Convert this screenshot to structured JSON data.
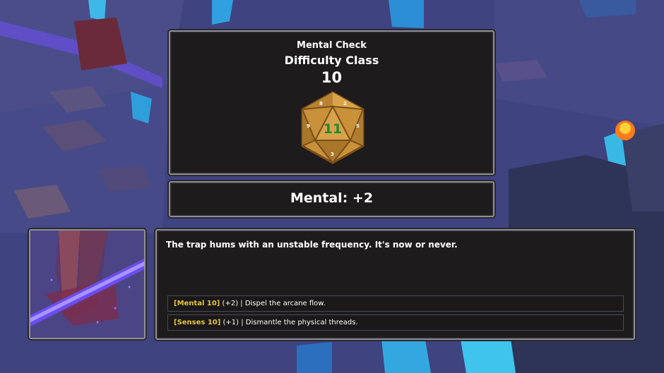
{
  "check": {
    "title": "Mental Check",
    "dc_label": "Difficulty Class",
    "dc_value": "10"
  },
  "die": {
    "icon": "d20-die-icon",
    "result": "11",
    "face_color": "#c8913a",
    "result_color": "#1e8a2e"
  },
  "modifier": {
    "text": "Mental: +2"
  },
  "portrait": {
    "icon": "arcane-trap-portrait"
  },
  "dialog": {
    "text": "The trap hums with an unstable frequency. It's now or never.",
    "options": [
      {
        "tag": "[Mental 10]",
        "bonus": "(+2)",
        "text": "| Dispel the arcane flow."
      },
      {
        "tag": "[Senses 10]",
        "bonus": "(+1)",
        "text": "| Dismantle the physical threads."
      }
    ]
  },
  "colors": {
    "accent_yellow": "#e8c53a",
    "panel_bg": "#1d1b1c",
    "panel_border": "#8f8f98"
  }
}
